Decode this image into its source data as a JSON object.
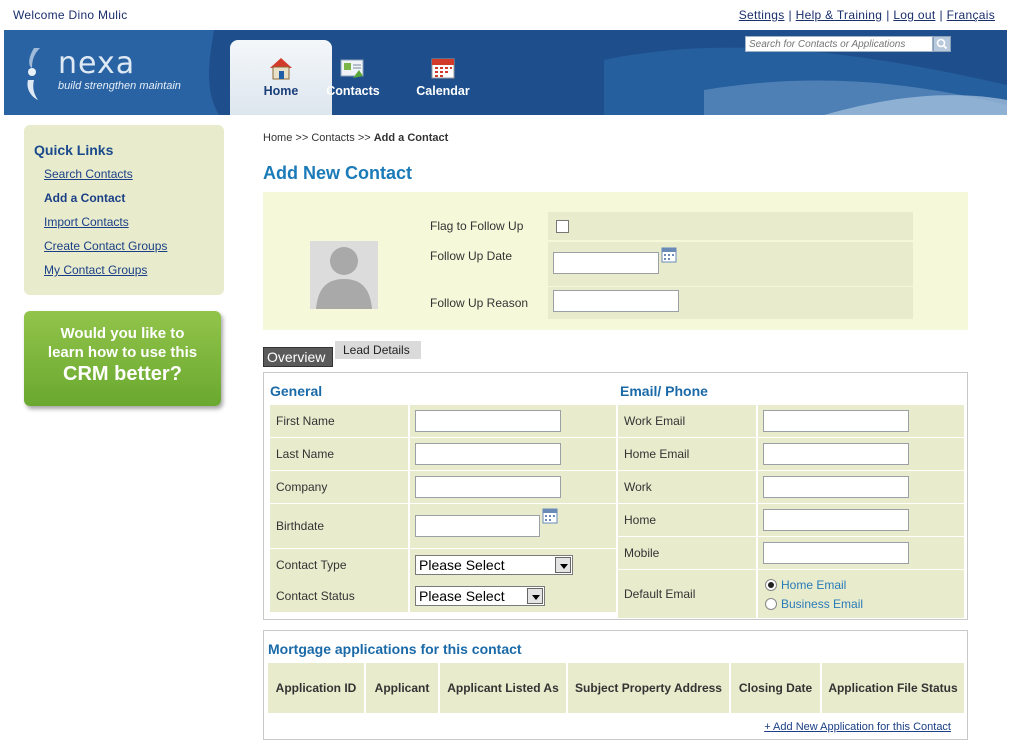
{
  "topbar": {
    "welcome": "Welcome Dino Mulic",
    "links": [
      "Settings",
      "Help & Training",
      "Log out",
      "Français"
    ]
  },
  "brand": {
    "name": "nexa",
    "tagline": "build strengthen maintain"
  },
  "nav": {
    "home": "Home",
    "contacts": "Contacts",
    "calendar": "Calendar",
    "active": "Home"
  },
  "search": {
    "placeholder": "Search for Contacts or Applications"
  },
  "sidebar": {
    "title": "Quick Links",
    "items": [
      "Search Contacts",
      "Add a Contact",
      "Import Contacts",
      "Create Contact Groups",
      "My Contact Groups"
    ],
    "current": "Add a Contact"
  },
  "promo": {
    "line1": "Would you like to",
    "line2": "learn how to use this",
    "line3": "CRM better?"
  },
  "breadcrumb": {
    "home": "Home",
    "sep": ">>",
    "contacts": "Contacts",
    "current": "Add a Contact"
  },
  "page": {
    "title": "Add New Contact"
  },
  "followup": {
    "flag_label": "Flag to Follow Up",
    "date_label": "Follow Up Date",
    "reason_label": "Follow Up Reason",
    "flag_checked": false,
    "date_value": "",
    "reason_value": ""
  },
  "tabs": {
    "overview": "Overview",
    "lead": "Lead Details",
    "selected": "Overview"
  },
  "general": {
    "title": "General",
    "first_name": "First Name",
    "last_name": "Last Name",
    "company": "Company",
    "birthdate": "Birthdate",
    "contact_type": "Contact Type",
    "contact_status": "Contact Status",
    "select_default": "Please Select"
  },
  "emailphone": {
    "title": "Email/ Phone",
    "work_email": "Work Email",
    "home_email": "Home Email",
    "work": "Work",
    "home": "Home",
    "mobile": "Mobile",
    "default_email": "Default Email",
    "opt_home": "Home Email",
    "opt_business": "Business Email",
    "selected": "Home Email"
  },
  "mortgage": {
    "title": "Mortgage applications for this contact",
    "columns": [
      "Application ID",
      "Applicant",
      "Applicant Listed As",
      "Subject Property Address",
      "Closing Date",
      "Application File Status"
    ],
    "add_link": "+ Add New Application for this Contact"
  },
  "colors": {
    "accent": "#1b7ab8",
    "header": "#1e4f8c",
    "panel": "#e8eccd",
    "panel_light": "#f5f9d9",
    "promo": "#7cb83a"
  }
}
